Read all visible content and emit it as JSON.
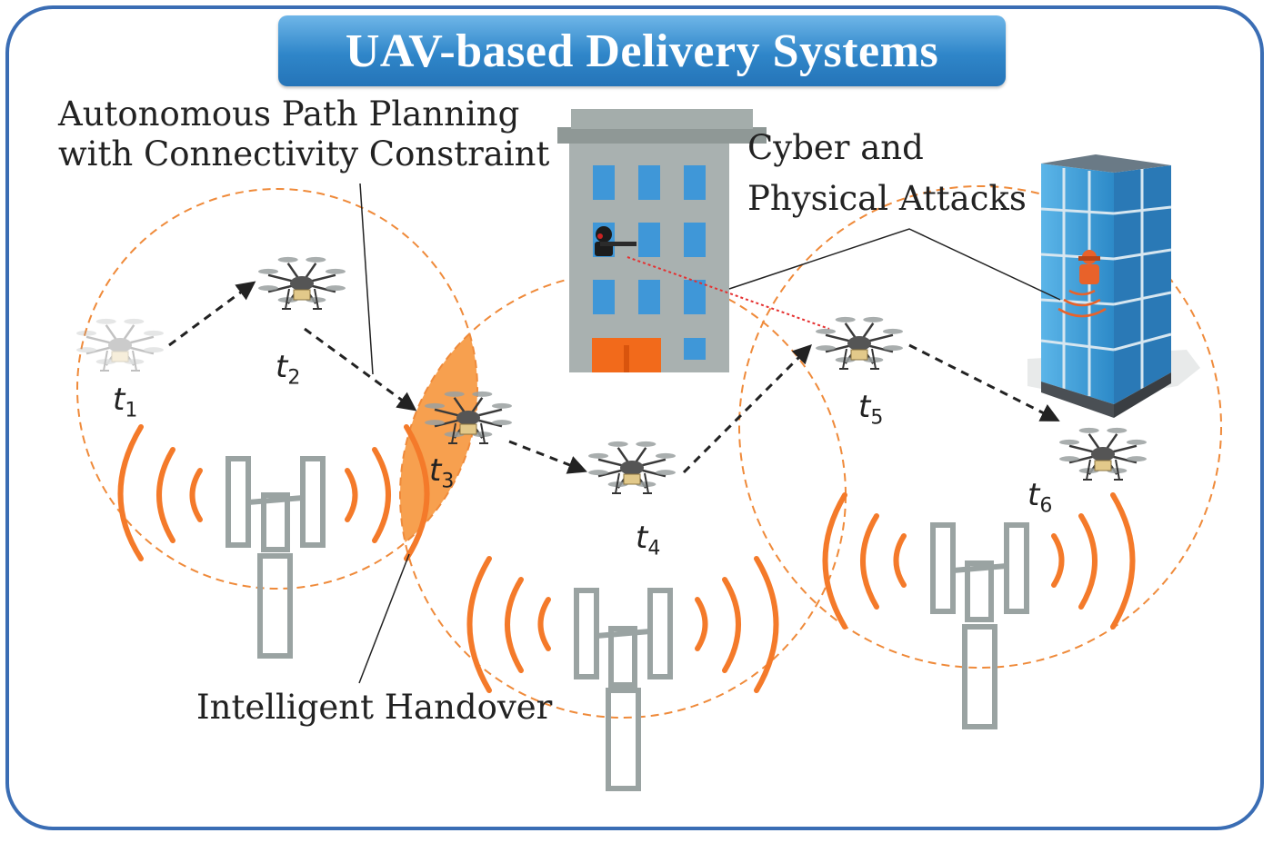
{
  "title": "UAV-based Delivery Systems",
  "labels": {
    "path_planning_line1": "Autonomous Path Planning",
    "path_planning_line2": "with Connectivity Constraint",
    "attacks_line1": "Cyber and",
    "attacks_line2": "Physical Attacks",
    "handover": "Intelligent Handover"
  },
  "time_steps": [
    {
      "t": "t",
      "sub": "1"
    },
    {
      "t": "t",
      "sub": "2"
    },
    {
      "t": "t",
      "sub": "3"
    },
    {
      "t": "t",
      "sub": "4"
    },
    {
      "t": "t",
      "sub": "5"
    },
    {
      "t": "t",
      "sub": "6"
    }
  ],
  "colors": {
    "frame": "#3a6db4",
    "signal": "#f47a2a",
    "coverage": "#ef8a3a",
    "handover_fill": "#f7a04f",
    "tower": "#9aa3a2",
    "attack_ray": "#e53030"
  },
  "icons": [
    "drone-icon",
    "cell-tower-icon",
    "office-building-icon",
    "glass-tower-icon",
    "attacker-icon",
    "jammer-icon"
  ]
}
